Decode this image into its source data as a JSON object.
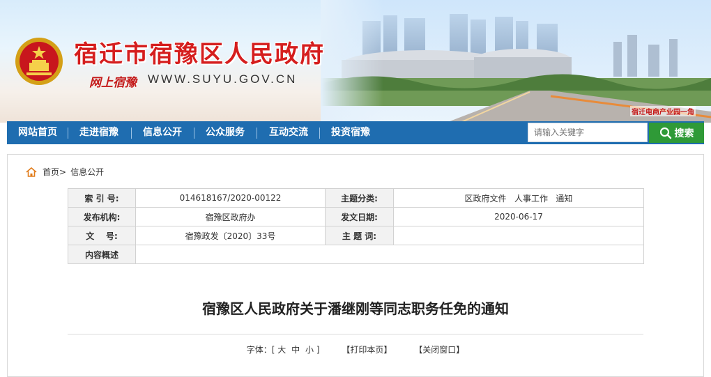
{
  "site": {
    "name": "宿迁市宿豫区人民政府",
    "tagline": "网上宿豫",
    "url": "WWW.SUYU.GOV.CN",
    "banner_caption": "宿迁电商产业园一角"
  },
  "nav": {
    "items": [
      "网站首页",
      "走进宿豫",
      "信息公开",
      "公众服务",
      "互动交流",
      "投资宿豫"
    ]
  },
  "search": {
    "placeholder": "请输入关键字",
    "button_label": "搜索"
  },
  "breadcrumb": {
    "home": "首页>",
    "current": "信息公开"
  },
  "meta": {
    "index_label": "索 引 号:",
    "index_value": "014618167/2020-00122",
    "category_label": "主题分类:",
    "category_value": "区政府文件   人事工作   通知",
    "publisher_label": "发布机构:",
    "publisher_value": "宿豫区政府办",
    "date_label": "发文日期:",
    "date_value": "2020-06-17",
    "doc_no_label": "文    号:",
    "doc_no_value": "宿豫政发〔2020〕33号",
    "keywords_label": "主 题 词:",
    "keywords_value": "",
    "summary_label": "内容概述",
    "summary_value": ""
  },
  "document": {
    "title": "宿豫区人民政府关于潘继刚等同志职务任免的通知"
  },
  "toolbar": {
    "font_label": "字体：[",
    "font_large": "大",
    "font_medium": "中",
    "font_small": "小",
    "font_close": "]",
    "print": "【打印本页】",
    "close": "【关闭窗口】"
  },
  "colors": {
    "nav_bg": "#1f6db0",
    "search_btn": "#2f9a37",
    "title_red": "#d51e1e"
  }
}
